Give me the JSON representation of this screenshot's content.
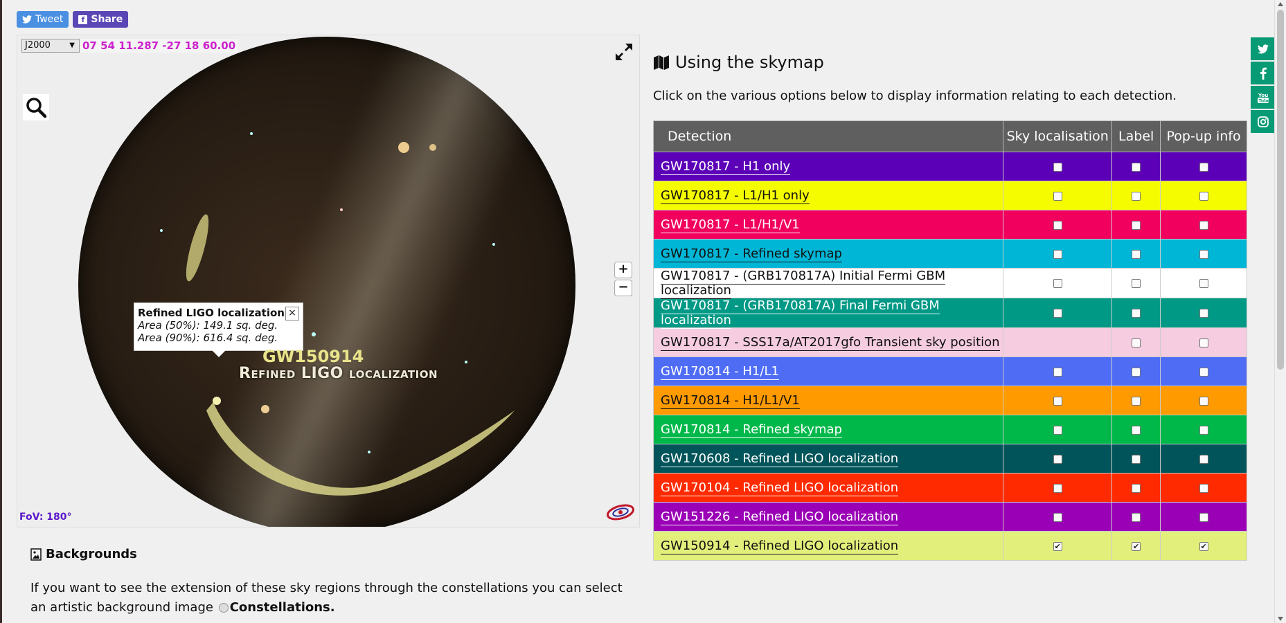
{
  "social_top": {
    "tweet_label": "Tweet",
    "share_label": "Share"
  },
  "skymap": {
    "frame_value": "J2000",
    "coordinates": "07 54 11.287 -27 18 60.00",
    "fov": "FoV: 180°",
    "zoom_in": "+",
    "zoom_out": "−",
    "popup": {
      "title": "Refined LIGO localization",
      "area50": "Area (50%): 149.1 sq. deg.",
      "area90": "Area (90%): 616.4 sq. deg.",
      "close": "×"
    },
    "overlay_label_event": "GW150914",
    "overlay_label_name": "Refined LIGO localization"
  },
  "backgrounds": {
    "title": "Backgrounds",
    "text": "If you want to see the extension of these sky regions through the constellations you can select an artistic background image",
    "option_label": "Constellations."
  },
  "panel": {
    "heading": "Using the skymap",
    "intro": "Click on the various options below to display information relating to each detection.",
    "columns": [
      "Detection",
      "Sky localisation",
      "Label",
      "Pop-up info"
    ]
  },
  "detections": [
    {
      "name": "GW170817 - H1 only",
      "bg": "#5b00b7",
      "fg": "#ffffff",
      "sky": false,
      "label": false,
      "popup": false,
      "has_sky": true
    },
    {
      "name": "GW170817 - L1/H1 only",
      "bg": "#f5fc00",
      "fg": "#111111",
      "sky": false,
      "label": false,
      "popup": false,
      "has_sky": true
    },
    {
      "name": "GW170817 - L1/H1/V1",
      "bg": "#f2005e",
      "fg": "#ffffff",
      "sky": false,
      "label": false,
      "popup": false,
      "has_sky": true
    },
    {
      "name": "GW170817 - Refined skymap",
      "bg": "#00b6d6",
      "fg": "#111111",
      "sky": false,
      "label": false,
      "popup": false,
      "has_sky": true
    },
    {
      "name": "GW170817 - (GRB170817A) Initial Fermi GBM localization",
      "bg": "#ffffff",
      "fg": "#111111",
      "sky": false,
      "label": false,
      "popup": false,
      "has_sky": true
    },
    {
      "name": "GW170817 - (GRB170817A) Final Fermi GBM localization",
      "bg": "#009986",
      "fg": "#ffffff",
      "sky": false,
      "label": false,
      "popup": false,
      "has_sky": true
    },
    {
      "name": "GW170817 - SSS17a/AT2017gfo Transient sky position",
      "bg": "#f5cce0",
      "fg": "#111111",
      "sky": false,
      "label": false,
      "popup": false,
      "has_sky": false
    },
    {
      "name": "GW170814 - H1/L1",
      "bg": "#4f6cf5",
      "fg": "#ffffff",
      "sky": false,
      "label": false,
      "popup": false,
      "has_sky": true
    },
    {
      "name": "GW170814 - H1/L1/V1",
      "bg": "#ff9a00",
      "fg": "#111111",
      "sky": false,
      "label": false,
      "popup": false,
      "has_sky": true
    },
    {
      "name": "GW170814 - Refined skymap",
      "bg": "#00b84a",
      "fg": "#ffffff",
      "sky": false,
      "label": false,
      "popup": false,
      "has_sky": true
    },
    {
      "name": "GW170608 - Refined LIGO localization",
      "bg": "#00545a",
      "fg": "#ffffff",
      "sky": false,
      "label": false,
      "popup": false,
      "has_sky": true
    },
    {
      "name": "GW170104 - Refined LIGO localization",
      "bg": "#ff2a00",
      "fg": "#ffffff",
      "sky": false,
      "label": false,
      "popup": false,
      "has_sky": true
    },
    {
      "name": "GW151226 - Refined LIGO localization",
      "bg": "#9a00b5",
      "fg": "#ffffff",
      "sky": false,
      "label": false,
      "popup": false,
      "has_sky": true
    },
    {
      "name": "GW150914 - Refined LIGO localization",
      "bg": "#e3ef7b",
      "fg": "#111111",
      "sky": true,
      "label": true,
      "popup": true,
      "has_sky": true
    }
  ],
  "side_social": [
    "twitter-icon",
    "facebook-icon",
    "youtube-icon",
    "instagram-icon"
  ],
  "colors": {
    "accent": "#089a75",
    "coords": "#cc22cc",
    "fov": "#5a18c9",
    "overlay": "#e3ef7b"
  }
}
